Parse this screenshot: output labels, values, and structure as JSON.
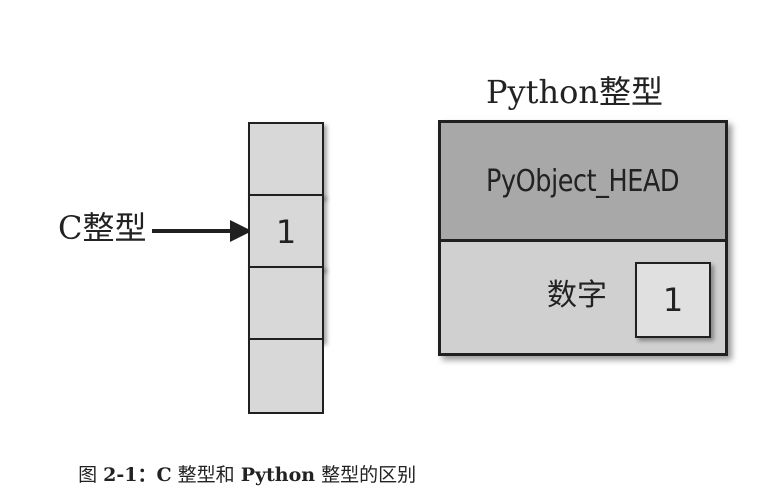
{
  "c_integer": {
    "label": "C整型",
    "cells": [
      "",
      "1",
      "",
      ""
    ]
  },
  "python_integer": {
    "title": "Python整型",
    "header_label": "PyObject_HEAD",
    "number_label": "数字",
    "number_value": "1"
  },
  "caption": {
    "prefix": "图 ",
    "number": "2-1",
    "colon": "：",
    "c_text": "C",
    "mid1": " 整型和 ",
    "python_text": "Python",
    "mid2": " 整型的区别"
  },
  "colors": {
    "cell_fill": "#d8d8d8",
    "header_fill": "#a8a8a8",
    "body_fill": "#d0d0d0",
    "stroke": "#202020"
  }
}
